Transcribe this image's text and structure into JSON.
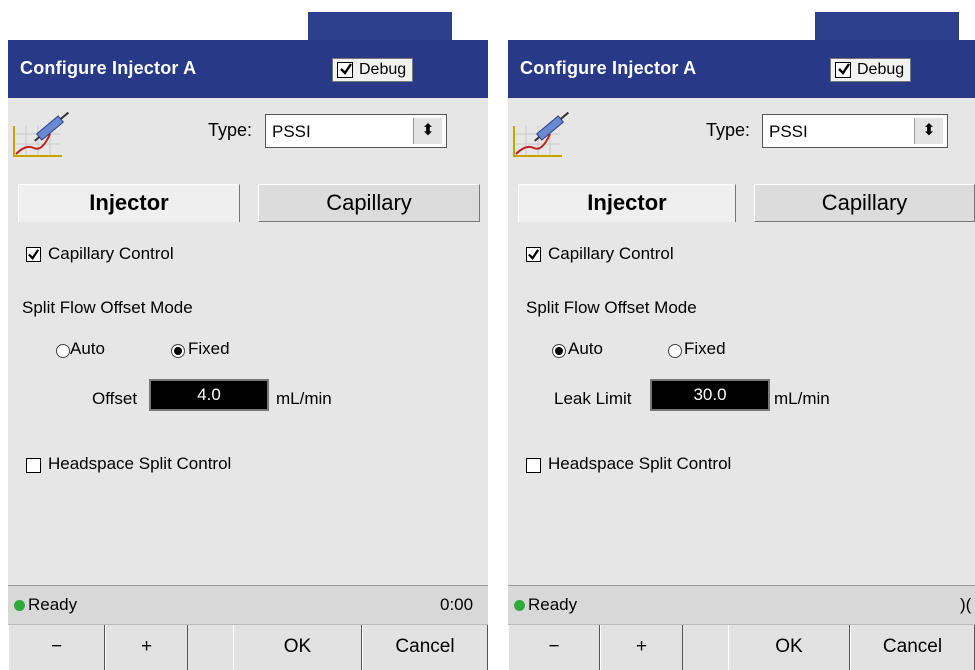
{
  "colors": {
    "titlebar": "#283a87",
    "accent": "#2b3f8c",
    "panel": "#e6e6e6",
    "status_led": "#2faa3a",
    "field_bg": "#000000"
  },
  "panels": [
    {
      "title": "Configure Injector A",
      "debug": {
        "label": "Debug",
        "checked": true
      },
      "type": {
        "label": "Type:",
        "value": "PSSI"
      },
      "tabs": [
        {
          "label": "Injector",
          "active": true
        },
        {
          "label": "Capillary",
          "active": false
        }
      ],
      "capillary_control": {
        "label": "Capillary Control",
        "checked": true
      },
      "split_mode": {
        "label": "Split Flow Offset Mode",
        "options": [
          {
            "label": "Auto",
            "selected": false
          },
          {
            "label": "Fixed",
            "selected": true
          }
        ]
      },
      "field": {
        "label": "Offset",
        "value": "4.0",
        "unit": "mL/min"
      },
      "headspace": {
        "label": "Headspace Split Control",
        "checked": false
      },
      "status": {
        "text": "Ready",
        "time": "0:00"
      },
      "buttons": {
        "minus": "−",
        "plus": "+",
        "ok": "OK",
        "cancel": "Cancel"
      },
      "icons": [
        "debug-check",
        "chart-syringe-icon",
        "select-arrows-icon",
        "status-led-icon"
      ]
    },
    {
      "title": "Configure Injector A",
      "debug": {
        "label": "Debug",
        "checked": true
      },
      "type": {
        "label": "Type:",
        "value": "PSSI"
      },
      "tabs": [
        {
          "label": "Injector",
          "active": true
        },
        {
          "label": "Capillary",
          "active": false
        }
      ],
      "capillary_control": {
        "label": "Capillary Control",
        "checked": true
      },
      "split_mode": {
        "label": "Split Flow Offset Mode",
        "options": [
          {
            "label": "Auto",
            "selected": true
          },
          {
            "label": "Fixed",
            "selected": false
          }
        ]
      },
      "field": {
        "label": "Leak Limit",
        "value": "30.0",
        "unit": "mL/min"
      },
      "headspace": {
        "label": "Headspace Split Control",
        "checked": false
      },
      "status": {
        "text": "Ready",
        "time": ")("
      },
      "buttons": {
        "minus": "−",
        "plus": "+",
        "ok": "OK",
        "cancel": "Cancel"
      },
      "icons": [
        "debug-check",
        "chart-syringe-icon",
        "select-arrows-icon",
        "status-led-icon"
      ]
    }
  ]
}
